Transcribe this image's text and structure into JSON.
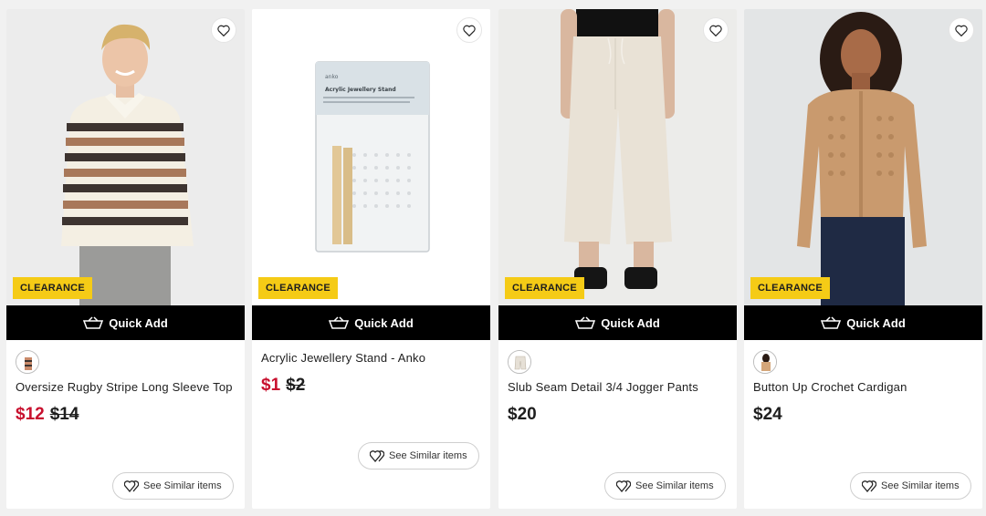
{
  "products": [
    {
      "badge": "CLEARANCE",
      "quick_add": "Quick Add",
      "title": "Oversize Rugby Stripe Long Sleeve Top",
      "price_now": "$12",
      "price_was": "$14",
      "similar": "See Similar items",
      "swatch_color": "#c98a6a",
      "has_swatch": true
    },
    {
      "badge": "CLEARANCE",
      "quick_add": "Quick Add",
      "title": "Acrylic Jewellery Stand - Anko",
      "price_now": "$1",
      "price_was": "$2",
      "similar": "See Similar items",
      "has_swatch": false,
      "package_brand": "anko",
      "package_title": "Acrylic Jewellery Stand"
    },
    {
      "badge": "CLEARANCE",
      "quick_add": "Quick Add",
      "title": "Slub Seam Detail 3/4 Jogger Pants",
      "price_now": "$20",
      "similar": "See Similar items",
      "swatch_color": "#e6e0d6",
      "has_swatch": true
    },
    {
      "badge": "CLEARANCE",
      "quick_add": "Quick Add",
      "title": "Button Up Crochet Cardigan",
      "price_now": "$24",
      "similar": "See Similar items",
      "swatch_color": "#d4a67a",
      "has_swatch": true
    }
  ],
  "colors": {
    "sale": "#c8102e",
    "badge": "#f5cb16",
    "quick_add_bg": "#000000"
  }
}
